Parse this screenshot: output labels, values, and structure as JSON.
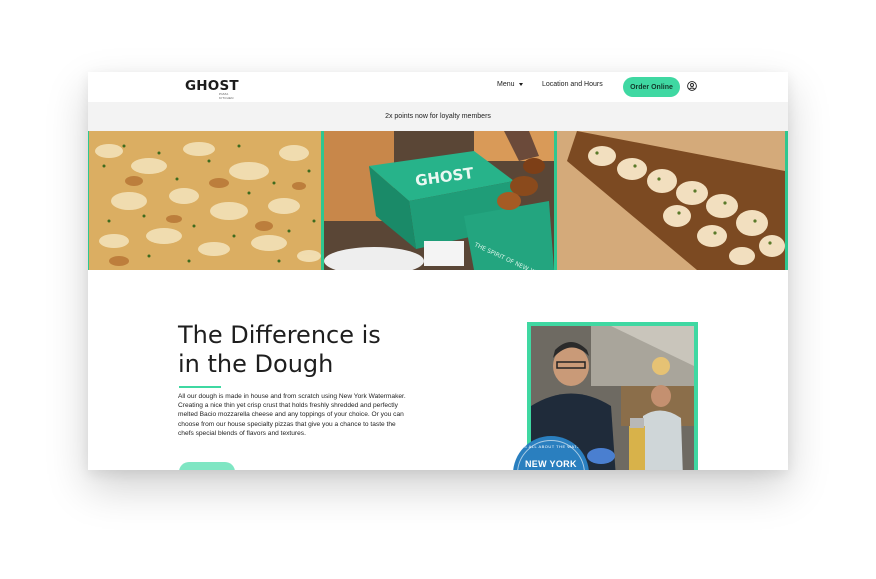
{
  "brand": {
    "logo_text": "GHOST",
    "logo_sub": "PIZZA KITCHEN",
    "accent": "#3fd8a2",
    "gallery_border": "#2ec790"
  },
  "nav": {
    "menu_label": "Menu",
    "location_label": "Location and Hours",
    "order_label": "Order Online",
    "account_icon": "user-circle-icon"
  },
  "promo": {
    "text": "2x points now for loyalty members"
  },
  "gallery": {
    "photos": [
      "pizza-slab-photo",
      "ghost-box-wings-photo",
      "garlic-knots-photo"
    ]
  },
  "box_text": {
    "brand": "GHOST",
    "slogan": "THE SPIRIT OF NEW YORK"
  },
  "section": {
    "heading_line1": "The Difference is",
    "heading_line2": "in the Dough",
    "body": "All our dough is made in house and from scratch using New York Watermaker. Creating a nice thin yet crisp crust that holds freshly shredded and perfectly melted Bacio mozzarella cheese and any toppings of your choice. Or you can choose from our house specialty pizzas that give you a chance to taste the chefs special blends of flavors and textures."
  },
  "badge": {
    "top": "IT'S ALL ABOUT THE WATER",
    "main": "NEW YORK"
  }
}
